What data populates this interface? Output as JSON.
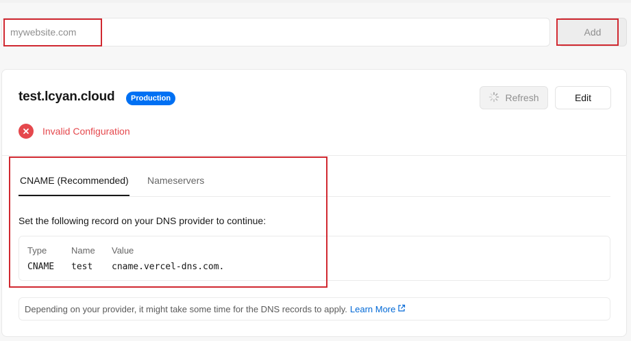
{
  "add_domain": {
    "placeholder": "mywebsite.com",
    "add_label": "Add"
  },
  "domain_card": {
    "domain": "test.lcyan.cloud",
    "environment_badge": "Production",
    "refresh_label": "Refresh",
    "edit_label": "Edit",
    "status": {
      "text": "Invalid Configuration",
      "icon": "x-circle-icon",
      "color": "#e5484d"
    },
    "tabs": [
      {
        "label": "CNAME (Recommended)",
        "active": true
      },
      {
        "label": "Nameservers",
        "active": false
      }
    ],
    "instruction": "Set the following record on your DNS provider to continue:",
    "record": {
      "headers": {
        "type": "Type",
        "name": "Name",
        "value": "Value"
      },
      "values": {
        "type": "CNAME",
        "name": "test",
        "value": "cname.vercel-dns.com."
      }
    },
    "note": {
      "text": "Depending on your provider, it might take some time for the DNS records to apply.",
      "link_label": "Learn More",
      "link_icon": "external-link-icon"
    }
  },
  "colors": {
    "accent": "#0070f3",
    "error": "#e5484d",
    "link": "#0068d6",
    "highlight": "#d0272f"
  }
}
